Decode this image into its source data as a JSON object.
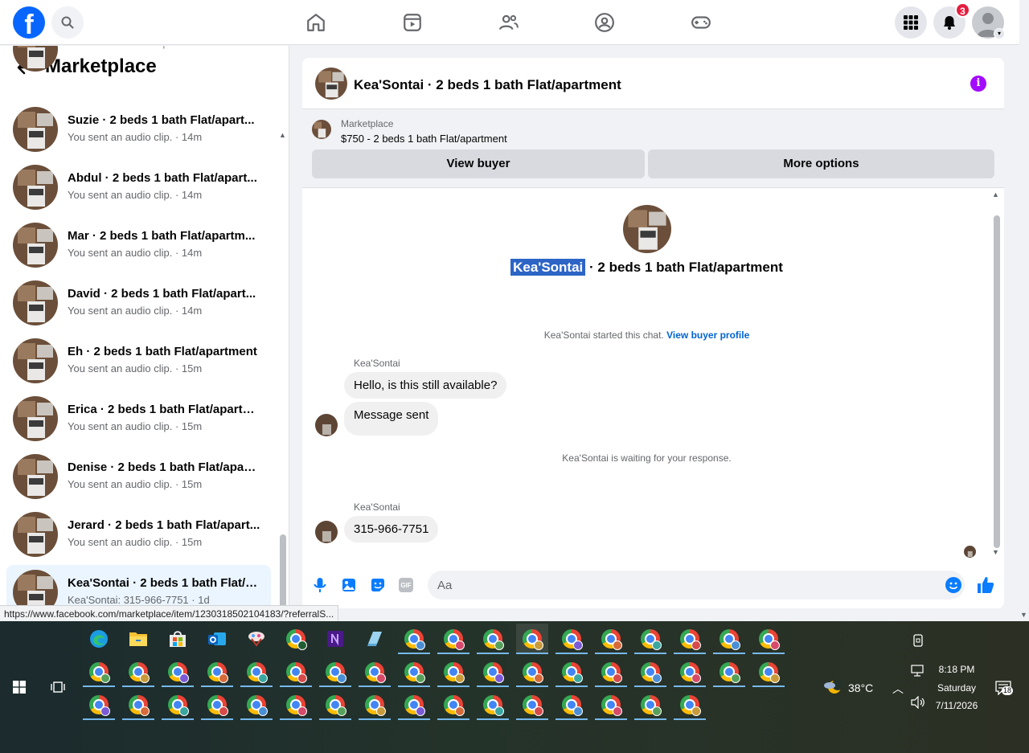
{
  "topnav": {
    "logo": "f",
    "notifications_count": "3",
    "icons": [
      "home-icon",
      "video-icon",
      "friends-icon",
      "groups-icon",
      "gaming-icon",
      "menu-grid-icon",
      "bell-icon"
    ]
  },
  "sidebar": {
    "title": "Marketplace",
    "partial_top_sub": ",",
    "conversations": [
      {
        "title": "Suzie · 2 beds 1 bath Flat/apart...",
        "sub": "You sent an audio clip. · 14m"
      },
      {
        "title": "Abdul · 2 beds 1 bath Flat/apart...",
        "sub": "You sent an audio clip. · 14m"
      },
      {
        "title": "Mar · 2 beds 1 bath Flat/apartm...",
        "sub": "You sent an audio clip. · 14m"
      },
      {
        "title": "David · 2 beds 1 bath Flat/apart...",
        "sub": "You sent an audio clip. · 14m"
      },
      {
        "title": "Eh · 2 beds 1 bath Flat/apartment",
        "sub": "You sent an audio clip. · 15m"
      },
      {
        "title": "Erica · 2 beds 1 bath Flat/apartm...",
        "sub": "You sent an audio clip. · 15m"
      },
      {
        "title": "Denise · 2 beds 1 bath Flat/apart...",
        "sub": "You sent an audio clip. · 15m"
      },
      {
        "title": "Jerard · 2 beds 1 bath Flat/apart...",
        "sub": "You sent an audio clip. · 15m"
      },
      {
        "title": "Kea'Sontai · 2 beds 1 bath Flat/a...",
        "sub": "Kea'Sontai: 315-966-7751 · 1d"
      }
    ]
  },
  "chat": {
    "header_title": "Kea'Sontai · 2 beds 1 bath Flat/apartment",
    "info": "i",
    "marketplace_label": "Marketplace",
    "listing": "$750 - 2 beds 1 bath Flat/apartment",
    "view_buyer": "View buyer",
    "more_options": "More options",
    "convo_name_highlight": "Kea'Sontai",
    "convo_name_rest": " · 2 beds 1 bath Flat/apartment",
    "started_text": "Kea'Sontai started this chat.",
    "view_buyer_profile": "View buyer profile",
    "sender1": "Kea'Sontai",
    "msg1": "Hello, is this still available?",
    "msg2": "Message sent",
    "waiting": "Kea'Sontai is waiting for your response.",
    "sender2": "Kea'Sontai",
    "msg3": "315-966-7751",
    "input_placeholder": "Aa",
    "gif": "GIF"
  },
  "status_url": "https://www.facebook.com/marketplace/item/1230318502104183/?referralS...",
  "taskbar": {
    "weather": "38°C",
    "time": "8:18 PM",
    "day": "Saturday",
    "date": "7/11/2026",
    "notif_count": "18"
  },
  "colors": {
    "fb_blue": "#0866ff",
    "messenger_blue": "#0a7cff",
    "purple_info": "#a30bff",
    "badge_red": "#e41e3f"
  }
}
